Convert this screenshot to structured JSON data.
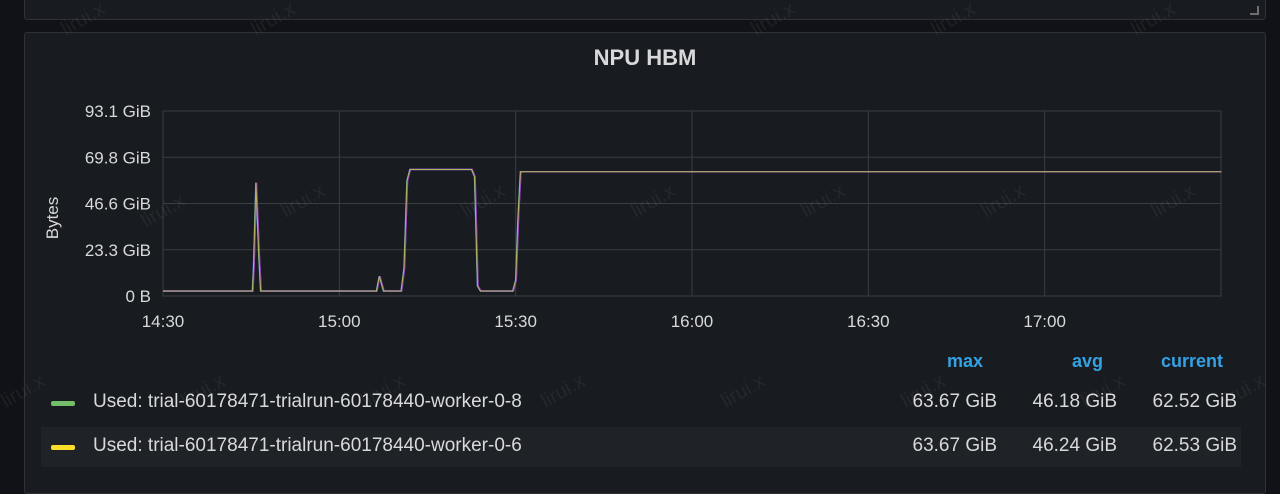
{
  "prev_panel": {
    "values": [
      "",
      "",
      ""
    ]
  },
  "panel": {
    "title": "NPU HBM"
  },
  "watermark": "lirui.x",
  "chart_data": {
    "type": "line",
    "title": "NPU HBM",
    "ylabel": "Bytes",
    "xlabel": "",
    "y_ticks": [
      "0 B",
      "23.3 GiB",
      "46.6 GiB",
      "69.8 GiB",
      "93.1 GiB"
    ],
    "ylim": [
      0,
      93.1
    ],
    "x_ticks": [
      "14:30",
      "15:00",
      "15:30",
      "16:00",
      "16:30",
      "17:00"
    ],
    "xlim_minutes": [
      0,
      180
    ],
    "grid": true,
    "legend_placement": "bottom",
    "series": [
      {
        "name": "Used: trial-60178471-trialrun-60178440-worker-0-8",
        "color": "#73bf69",
        "max": "63.67 GiB",
        "avg": "46.18 GiB",
        "current": "62.52 GiB"
      },
      {
        "name": "Used: trial-60178471-trialrun-60178440-worker-0-6",
        "color": "#fade2a",
        "max": "63.67 GiB",
        "avg": "46.24 GiB",
        "current": "62.53 GiB"
      }
    ],
    "line_profile": {
      "x_minutes": [
        0,
        15.2,
        15.4,
        15.8,
        16.3,
        16.6,
        16.9,
        36.3,
        36.8,
        37.5,
        38.0,
        40.5,
        41.0,
        41.5,
        42.0,
        42.5,
        43.0,
        52.5,
        53.0,
        53.5,
        54.0,
        59.5,
        60.0,
        60.4,
        60.8,
        61.3,
        180
      ],
      "y_gib": [
        2.5,
        2.5,
        15,
        57,
        20,
        2.5,
        2.5,
        2.5,
        10,
        2.5,
        2.5,
        2.5,
        14,
        58,
        63.67,
        63.67,
        63.67,
        63.67,
        60,
        5,
        2.5,
        2.5,
        8,
        40,
        62.52,
        62.52,
        62.52
      ]
    }
  },
  "legend": {
    "headers": {
      "max": "max",
      "avg": "avg",
      "current": "current"
    }
  }
}
